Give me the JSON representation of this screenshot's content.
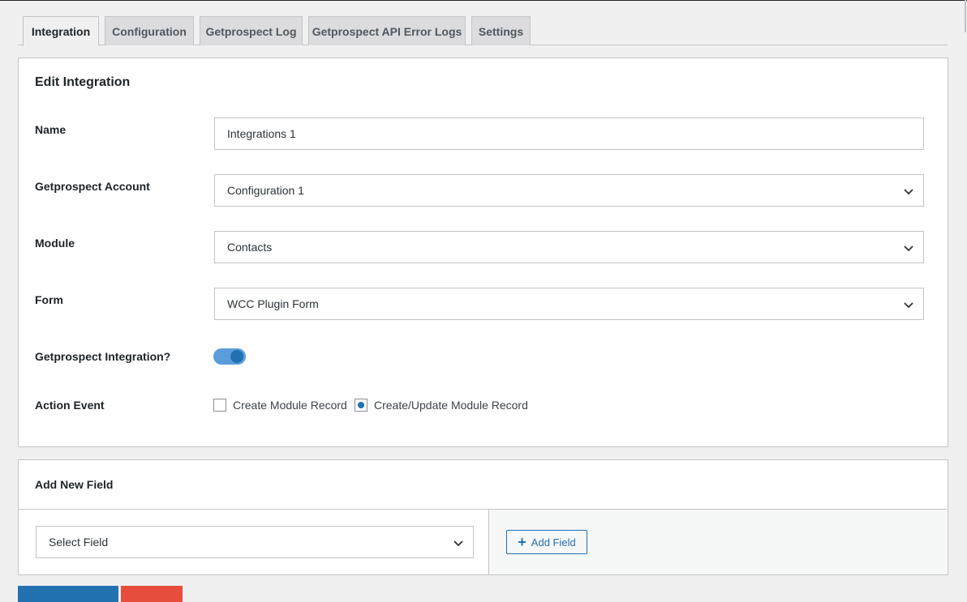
{
  "tabs": [
    {
      "label": "Integration"
    },
    {
      "label": "Configuration"
    },
    {
      "label": "Getprospect Log"
    },
    {
      "label": "Getprospect API Error Logs"
    },
    {
      "label": "Settings"
    }
  ],
  "edit": {
    "title": "Edit Integration",
    "name_label": "Name",
    "name_value": "Integrations 1",
    "account_label": "Getprospect Account",
    "account_value": "Configuration 1",
    "module_label": "Module",
    "module_value": "Contacts",
    "form_label": "Form",
    "form_value": "WCC Plugin Form",
    "integration_label": "Getprospect Integration?",
    "integration_enabled": true,
    "action_label": "Action Event",
    "action_options": [
      {
        "label": "Create Module Record",
        "checked": false
      },
      {
        "label": "Create/Update Module Record",
        "checked": true
      }
    ]
  },
  "add_field": {
    "title": "Add New Field",
    "select_value": "Select Field",
    "button_label": "Add Field"
  },
  "colors": {
    "accent": "#2271b1",
    "danger": "#e74c3c"
  }
}
